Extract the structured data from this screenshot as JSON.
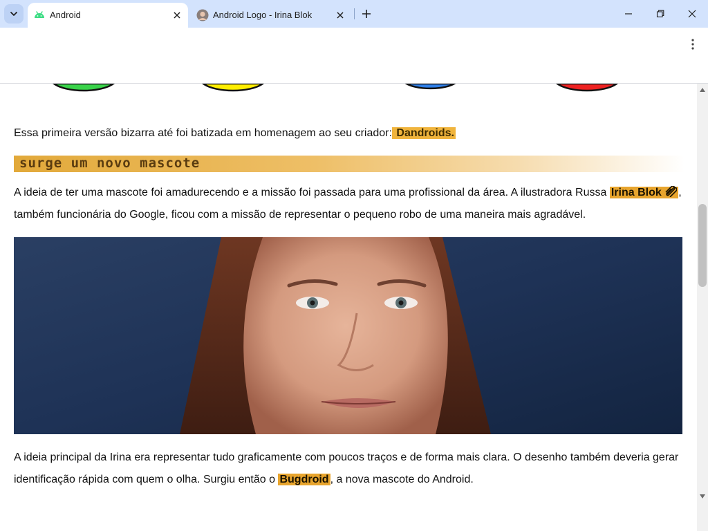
{
  "browser": {
    "tabs": [
      {
        "title": "Android",
        "active": true,
        "icon": "android-icon"
      },
      {
        "title": "Android Logo - Irina Blok",
        "active": false,
        "icon": "avatar-icon"
      }
    ],
    "new_tab_icon": "plus-icon",
    "menu_icon": "kebab-menu-icon",
    "window_controls": [
      "minimize-icon",
      "restore-icon",
      "close-icon"
    ]
  },
  "article": {
    "intro": {
      "text_before": "Essa primeira versão bizarra até foi batizada em homenagem ao seu criador:",
      "highlight": " Dandroids."
    },
    "section_heading": "Surge um novo mascote",
    "paragraph1": {
      "text_before": "A ideia de ter uma mascote foi amadurecendo e a missão foi passada para uma profissional da área. A ilustradora Russa ",
      "link_text": "Irina Blok",
      "link_icon": "link-icon",
      "text_after": ", também funcionária do Google, ficou com a missão de representar o pequeno robo de uma maneira mais agradável."
    },
    "photo_alt": "portrait-photo",
    "paragraph2": {
      "text_before": "A ideia principal da Irina era representar tudo graficamente com poucos traços e de forma mais clara. O desenho também deveria gerar identificação rápida com quem o olha. Surgiu então o ",
      "highlight": "Bugdroid",
      "text_after": ", a nova mascote do Android."
    },
    "circle_colors": [
      "#39d34a",
      "#ffee00",
      "#2f7fe8",
      "#ee2222"
    ]
  },
  "colors": {
    "tabbar_bg": "#d3e3fd",
    "highlight": "#f0b43c"
  }
}
